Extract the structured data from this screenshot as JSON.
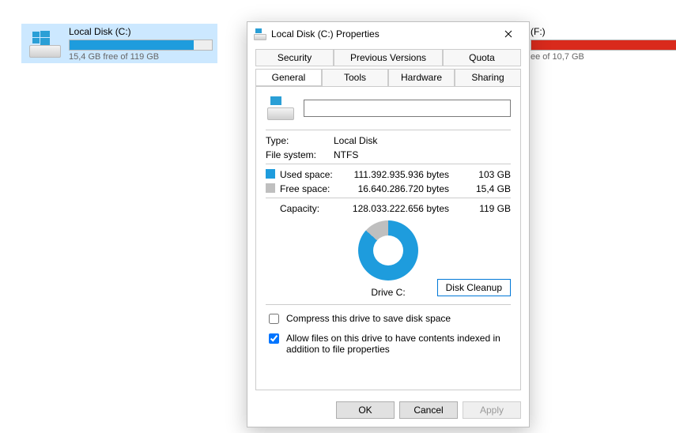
{
  "drives": {
    "c": {
      "name": "Local Disk (C:)",
      "free_text": "15,4 GB free of 119 GB",
      "bar_color": "#1e9cdd",
      "fill_pct": 87
    },
    "f": {
      "name": "(F:)",
      "free_text": "ee of 10,7 GB",
      "bar_color": "#d92a1c",
      "fill_pct": 100
    }
  },
  "dialog": {
    "title": "Local Disk (C:) Properties",
    "tabs_top": {
      "security": "Security",
      "prev": "Previous Versions",
      "quota": "Quota"
    },
    "tabs_bottom": {
      "general": "General",
      "tools": "Tools",
      "hardware": "Hardware",
      "sharing": "Sharing"
    },
    "name_value": "",
    "type_label": "Type:",
    "type_value": "Local Disk",
    "fs_label": "File system:",
    "fs_value": "NTFS",
    "used_label": "Used space:",
    "used_bytes": "111.392.935.936 bytes",
    "used_h": "103 GB",
    "used_color": "#1e9cdd",
    "free_label": "Free space:",
    "free_bytes": "16.640.286.720 bytes",
    "free_h": "15,4 GB",
    "free_color": "#bfbfbf",
    "cap_label": "Capacity:",
    "cap_bytes": "128.033.222.656 bytes",
    "cap_h": "119 GB",
    "drive_label": "Drive C:",
    "cleanup": "Disk Cleanup",
    "compress_label": "Compress this drive to save disk space",
    "index_label": "Allow files on this drive to have contents indexed in addition to file properties",
    "ok": "OK",
    "cancel": "Cancel",
    "apply": "Apply"
  }
}
